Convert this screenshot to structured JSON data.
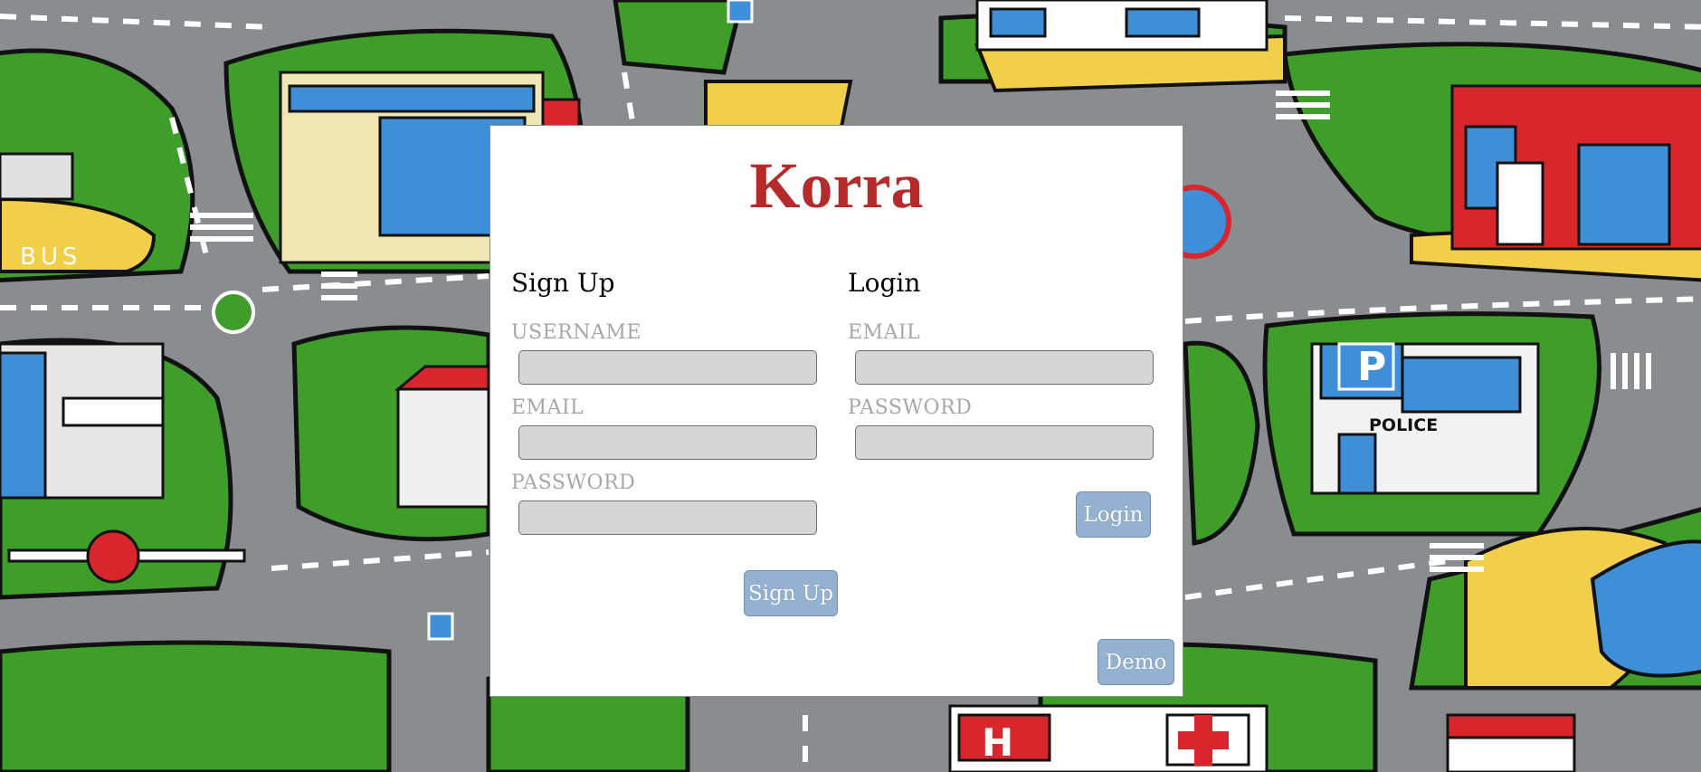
{
  "app": {
    "title": "Korra"
  },
  "signup": {
    "heading": "Sign Up",
    "username_label": "USERNAME",
    "email_label": "EMAIL",
    "password_label": "PASSWORD",
    "username_value": "",
    "email_value": "",
    "password_value": "",
    "submit_label": "Sign Up"
  },
  "login": {
    "heading": "Login",
    "email_label": "EMAIL",
    "password_label": "PASSWORD",
    "email_value": "",
    "password_value": "",
    "submit_label": "Login"
  },
  "demo": {
    "label": "Demo"
  },
  "background": {
    "labels": {
      "bus": "BUS",
      "police": "POLICE",
      "parking": "P",
      "hospital": "H"
    },
    "colors": {
      "road": "#8a8d8f",
      "grass": "#3f9d2a",
      "sand": "#f2cf4a",
      "red": "#d8262c",
      "blue": "#3f8fd8",
      "white": "#ffffff"
    }
  },
  "colors": {
    "brand": "#b52a2a",
    "button_bg": "#93b1d0",
    "input_bg": "#d6d6d6",
    "label": "#a7a7a7"
  }
}
